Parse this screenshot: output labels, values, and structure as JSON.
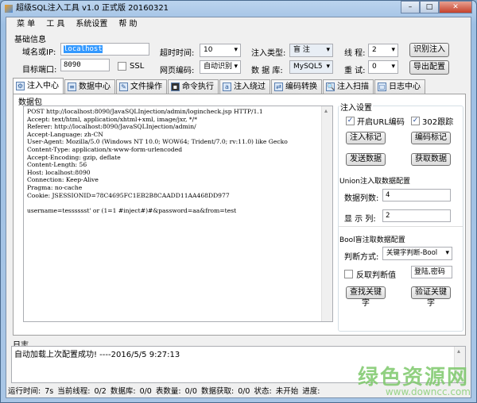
{
  "window": {
    "title": "超级SQL注入工具 v1.0 正式版 20160321",
    "buttons": [
      "minimize",
      "maximize",
      "close"
    ]
  },
  "menu": [
    "菜 单",
    "工 具",
    "系统设置",
    "帮 助"
  ],
  "basic": {
    "group_label": "基础信息",
    "domain_label": "域名或IP:",
    "domain_value": "localhost",
    "port_label": "目标端口:",
    "port_value": "8090",
    "ssl_label": "SSL",
    "ssl_checked": false,
    "timeout_label": "超时时间:",
    "timeout_value": "10",
    "encoding_label": "网页编码:",
    "encoding_value": "自动识别",
    "inject_type_label": "注入类型:",
    "inject_type_value": "盲 注",
    "db_label": "数 据 库:",
    "db_value": "MySQL5",
    "threads_label": "线 程:",
    "threads_value": "2",
    "retry_label": "重 试:",
    "retry_value": "0",
    "identify_btn": "识别注入",
    "export_btn": "导出配置"
  },
  "tabs": [
    {
      "label": "注入中心",
      "icon": "gear-icon",
      "active": true
    },
    {
      "label": "数据中心",
      "icon": "database-icon"
    },
    {
      "label": "文件操作",
      "icon": "file-edit-icon"
    },
    {
      "label": "命令执行",
      "icon": "terminal-icon"
    },
    {
      "label": "注入绕过",
      "icon": "bypass-icon"
    },
    {
      "label": "编码转换",
      "icon": "convert-icon"
    },
    {
      "label": "注入扫描",
      "icon": "scan-icon"
    },
    {
      "label": "日志中心",
      "icon": "book-icon"
    }
  ],
  "packet": {
    "label": "数据包",
    "content": "POST http://localhost:8090/JavaSQLInjection/admin/logincheck.jsp HTTP/1.1\nAccept: text/html, application/xhtml+xml, image/jxr, */*\nReferer: http://localhost:8090/JavaSQLInjection/admin/\nAccept-Language: zh-CN\nUser-Agent: Mozilla/5.0 (Windows NT 10.0; WOW64; Trident/7.0; rv:11.0) like Gecko\nContent-Type: application/x-www-form-urlencoded\nAccept-Encoding: gzip, deflate\nContent-Length: 56\nHost: localhost:8090\nConnection: Keep-Alive\nPragma: no-cache\nCookie: JSESSIONID=78C4695FC1EB2B8CAADD11AA468DD977\n\nusername=tesssssst' or (1=1 #inject#)#&password=aa&from=test"
  },
  "settings": {
    "label": "注入设置",
    "url_encode_label": "开启URL编码",
    "url_encode_checked": true,
    "redirect_label": "302跟踪",
    "redirect_checked": true,
    "mark_btn": "注入标记",
    "encode_mark_btn": "编码标记",
    "send_btn": "发送数据",
    "fetch_btn": "获取数据"
  },
  "union": {
    "label": "Union注入取数据配置",
    "cols_label": "数据列数:",
    "cols_value": "4",
    "show_label": "显 示 列:",
    "show_value": "2"
  },
  "bool": {
    "label": "Bool盲注取数据配置",
    "method_label": "判断方式:",
    "method_value": "关键字判断-Bool",
    "invert_label": "反取判断值",
    "invert_checked": false,
    "keyword_value": "登陆,密码",
    "find_btn": "查找关键字",
    "verify_btn": "验证关键字"
  },
  "log": {
    "label": "日志",
    "content": "自动加载上次配置成功! ----2016/5/5 9:27:13"
  },
  "status": {
    "runtime_label": "运行时间:",
    "runtime": "7s",
    "thread_label": "当前线程:",
    "thread": "0/2",
    "db_label": "数据库:",
    "db": "0/0",
    "table_label": "表数量:",
    "table": "0/0",
    "data_label": "数据获取:",
    "data": "0/0",
    "state_label": "状态:",
    "state": "未开始",
    "progress_label": "进度:"
  },
  "watermark": {
    "text": "绿色资源网",
    "url": "www.downcc.com"
  }
}
